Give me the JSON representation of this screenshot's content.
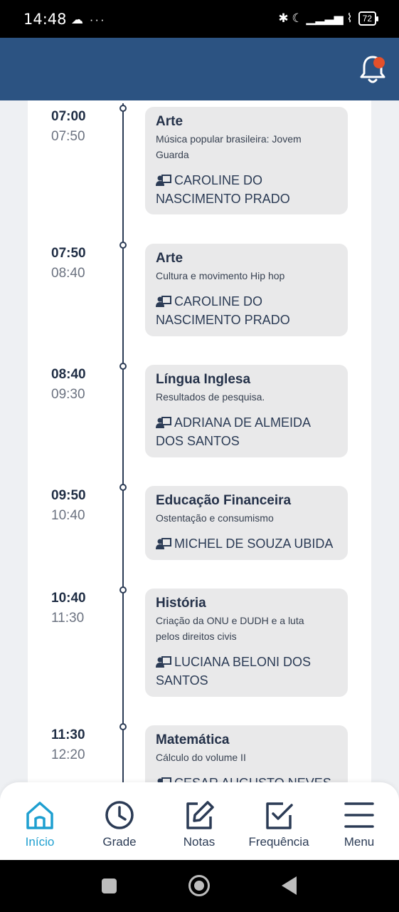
{
  "status_bar": {
    "time": "14:48",
    "left_icons": "☁ ···",
    "right_icons": "✱ ☾ ▁▂▃▅ ⌇",
    "battery": "72"
  },
  "header": {
    "notification_icon": "bell-icon",
    "has_notification": true,
    "accent_color": "#2c5382",
    "badge_color": "#e4502b"
  },
  "schedule": [
    {
      "start": "07:00",
      "end": "07:50",
      "subject": "Arte",
      "topic": [
        "Música popular brasileira: Jovem",
        "Guarda"
      ],
      "teacher": [
        "CAROLINE DO",
        "NASCIMENTO PRADO"
      ]
    },
    {
      "start": "07:50",
      "end": "08:40",
      "subject": "Arte",
      "topic": [
        "Cultura e movimento Hip hop"
      ],
      "teacher": [
        "CAROLINE DO",
        "NASCIMENTO PRADO"
      ]
    },
    {
      "start": "08:40",
      "end": "09:30",
      "subject": "Língua Inglesa",
      "topic": [
        "Resultados de pesquisa."
      ],
      "teacher": [
        "ADRIANA DE ALMEIDA",
        "DOS SANTOS"
      ]
    },
    {
      "start": "09:50",
      "end": "10:40",
      "subject": "Educação Financeira",
      "topic": [
        "Ostentação e consumismo"
      ],
      "teacher": [
        "MICHEL DE SOUZA UBIDA"
      ]
    },
    {
      "start": "10:40",
      "end": "11:30",
      "subject": "História",
      "topic": [
        "Criação da ONU e DUDH e a luta",
        "pelos direitos civis"
      ],
      "teacher": [
        "LUCIANA BELONI DOS",
        "SANTOS"
      ]
    },
    {
      "start": "11:30",
      "end": "12:20",
      "subject": "Matemática",
      "topic": [
        "Cálculo do volume II"
      ],
      "teacher": [
        "CESAR AUGUSTO NEVES"
      ]
    }
  ],
  "bottom_nav": {
    "items": [
      {
        "label": "Início",
        "icon": "home-icon",
        "active": true
      },
      {
        "label": "Grade",
        "icon": "clock-icon",
        "active": false
      },
      {
        "label": "Notas",
        "icon": "edit-icon",
        "active": false
      },
      {
        "label": "Frequência",
        "icon": "checkbox-icon",
        "active": false
      },
      {
        "label": "Menu",
        "icon": "hamburger-icon",
        "active": false
      }
    ],
    "active_color": "#1e9fd0"
  }
}
